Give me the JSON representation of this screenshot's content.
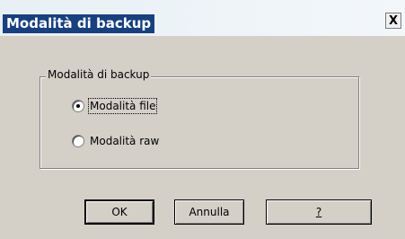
{
  "dialog": {
    "title": "Modalità di backup",
    "close_label": "X"
  },
  "group": {
    "legend": "Modalità di backup",
    "options": [
      {
        "label": "Modalità file",
        "checked": true
      },
      {
        "label": "Modalità raw",
        "checked": false
      }
    ]
  },
  "buttons": {
    "ok": "OK",
    "cancel": "Annulla",
    "help": "?"
  },
  "colors": {
    "title_highlight": "#18407f",
    "dialog_face": "#d4d0c8"
  },
  "icons": {
    "close": "close-icon"
  }
}
